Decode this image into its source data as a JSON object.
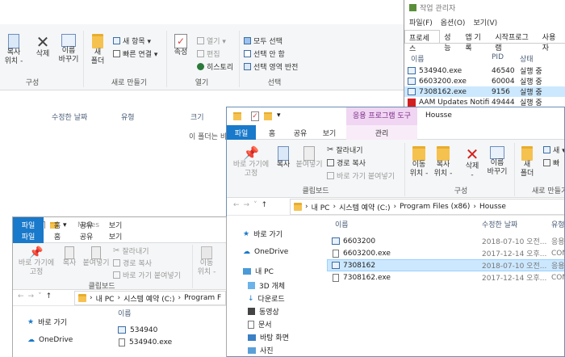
{
  "back_window": {
    "ribbon": {
      "copy_path_label": "복사\n위치 -",
      "delete_label": "삭제",
      "rename_label": "이름\n바꾸기",
      "organize_group": "구성",
      "new_folder_label": "새\n폴더",
      "new_item_label": "새 항목 ▾",
      "easy_access_label": "빠른 연결 ▾",
      "new_group": "새로 만들기",
      "properties_label": "속성",
      "open_label": "열기 ▾",
      "edit_label": "편집",
      "history_label": "히스토리",
      "open_group": "열기",
      "select_all_label": "모두 선택",
      "select_none_label": "선택 안 함",
      "invert_selection_label": "선택 영역 반전",
      "select_group": "선택"
    },
    "columns": {
      "date": "수정한 날짜",
      "type": "유형",
      "size": "크기"
    },
    "empty_message": "이 폴더는 비어 있습니다."
  },
  "task_manager": {
    "title": "작업 관리자",
    "menu": [
      "파일(F)",
      "옵션(O)",
      "보기(V)"
    ],
    "tabs": [
      "프로세스",
      "성능",
      "앱 기록",
      "시작프로그램",
      "사용자"
    ],
    "columns": {
      "name": "이름",
      "pid": "PID",
      "status": "상태"
    },
    "rows": [
      {
        "name": "534940.exe",
        "pid": "46540",
        "status": "실행 중",
        "selected": false
      },
      {
        "name": "6603200.exe",
        "pid": "60004",
        "status": "실행 중",
        "selected": false
      },
      {
        "name": "7308162.exe",
        "pid": "9156",
        "status": "실행 중",
        "selected": true
      },
      {
        "name": "AAM Updates Notifi...",
        "pid": "49444",
        "status": "실행 중",
        "selected": false
      }
    ]
  },
  "housse_window": {
    "context_tab_title": "응용 프로그램 도구",
    "title": "Housse",
    "tabs": [
      "파일",
      "홈",
      "공유",
      "보기"
    ],
    "context_tab": "관리",
    "ribbon": {
      "pin_label": "바로 가기에\n고정",
      "copy_label": "복사",
      "paste_label": "붙여넣기",
      "cut_label": "잘라내기",
      "copy_path_label": "경로 복사",
      "paste_shortcut_label": "바로 가기 붙여넣기",
      "clipboard_group": "클립보드",
      "move_label": "이동\n위치 -",
      "copyto_label": "복사\n위치 -",
      "delete_label": "삭제\n-",
      "rename_label": "이름\n바꾸기",
      "organize_group": "구성",
      "new_folder_label": "새\n폴더",
      "new_item_label": "새 ▾",
      "easy_label": "빠",
      "new_group": "새로 만들기"
    },
    "breadcrumb": [
      "내 PC",
      "시스템 예약 (C:)",
      "Program Files (x86)",
      "Housse"
    ],
    "nav": {
      "quick_access": "바로 가기",
      "onedrive": "OneDrive",
      "this_pc": "내 PC",
      "objects3d": "3D 개체",
      "downloads": "다운로드",
      "videos": "동영상",
      "documents": "문서",
      "desktop": "바탕 화면",
      "pictures": "사진"
    },
    "columns": {
      "name": "이름",
      "date": "수정한 날짜",
      "type": "유형"
    },
    "files": [
      {
        "name": "6603200",
        "date": "2018-07-10 오전...",
        "type": "응용",
        "selected": false
      },
      {
        "name": "6603200.exe",
        "date": "2017-12-14 오후...",
        "type": "CON",
        "selected": false
      },
      {
        "name": "7308162",
        "date": "2018-07-10 오전...",
        "type": "응용",
        "selected": true
      },
      {
        "name": "7308162.exe",
        "date": "2017-12-14 오후...",
        "type": "CON",
        "selected": false
      }
    ]
  },
  "motes_window": {
    "title": "Motes",
    "tabs": [
      "파일",
      "홈",
      "공유",
      "보기"
    ],
    "ribbon": {
      "pin_label": "바로 가기에\n고정",
      "copy_label": "복사",
      "paste_label": "붙여넣기",
      "cut_label": "잘라내기",
      "copy_path_label": "경로 복사",
      "paste_shortcut_label": "바로 가기 붙여넣기",
      "clipboard_group": "클립보드",
      "move_label": "이동\n위치 -"
    },
    "breadcrumb": [
      "내 PC",
      "시스템 예약 (C:)",
      "Program F"
    ],
    "nav": {
      "quick_access": "바로 가기",
      "onedrive": "OneDrive"
    },
    "columns": {
      "name": "이름"
    },
    "files": [
      {
        "name": "534940"
      },
      {
        "name": "534940.exe"
      }
    ]
  }
}
